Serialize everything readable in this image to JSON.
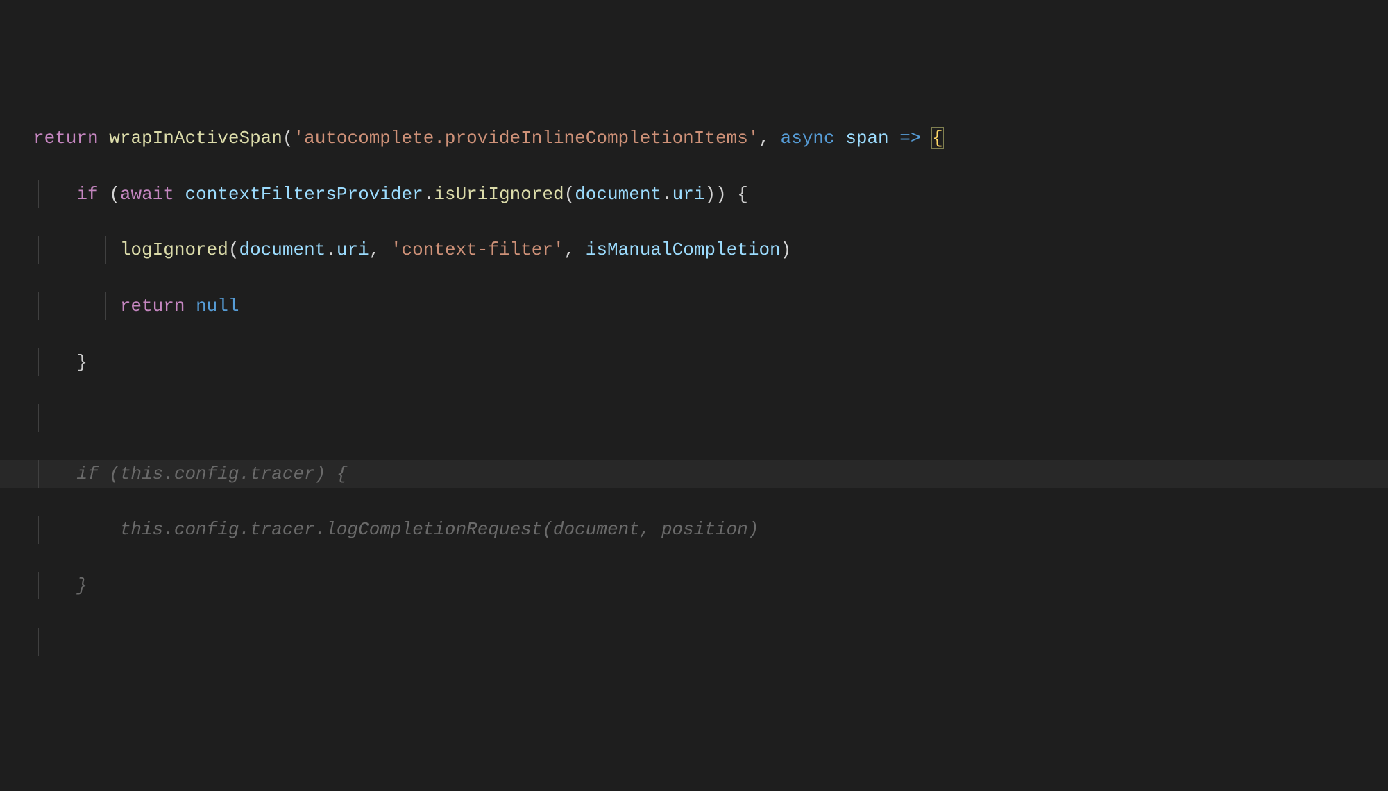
{
  "colors": {
    "background": "#1e1e1e",
    "keyword": "#c586c0",
    "function": "#dcdcaa",
    "string": "#ce9178",
    "storage": "#569cd6",
    "variable": "#9cdcfe",
    "ghost": "#6a6a6a",
    "braceMatch": "#ffd866"
  },
  "code": {
    "line1": {
      "kw_return": "return",
      "fn": "wrapInActiveSpan",
      "p_open": "(",
      "str": "'autocomplete.provideInlineCompletionItems'",
      "comma": ", ",
      "kw_async": "async",
      "sp": " ",
      "param": "span",
      "sp2": " ",
      "arrow": "=>",
      "sp3": " ",
      "brace": "{"
    },
    "line2": {
      "kw_if": "if",
      "sp": " ",
      "p": "(",
      "kw_await": "await",
      "sp2": " ",
      "obj": "contextFiltersProvider",
      "dot": ".",
      "method": "isUriIgnored",
      "p2": "(",
      "arg_obj": "document",
      "dot2": ".",
      "arg_prop": "uri",
      "p3": ")",
      "p4": ")",
      "sp3": " ",
      "brace": "{"
    },
    "line3": {
      "fn": "logIgnored",
      "p": "(",
      "arg_obj": "document",
      "dot": ".",
      "arg_prop": "uri",
      "c1": ", ",
      "str": "'context-filter'",
      "c2": ", ",
      "arg2": "isManualCompletion",
      "p2": ")"
    },
    "line4": {
      "kw_return": "return",
      "sp": " ",
      "null": "null"
    },
    "line5": {
      "brace": "}"
    },
    "suggestion": {
      "line1": "if (this.config.tracer) {",
      "line2": "    this.config.tracer.logCompletionRequest(document, position)",
      "line3": "}"
    }
  },
  "indent": {
    "l1": "",
    "l2": "    ",
    "l3": "        ",
    "l4": "        ",
    "l5": "    ",
    "sug": "    "
  }
}
